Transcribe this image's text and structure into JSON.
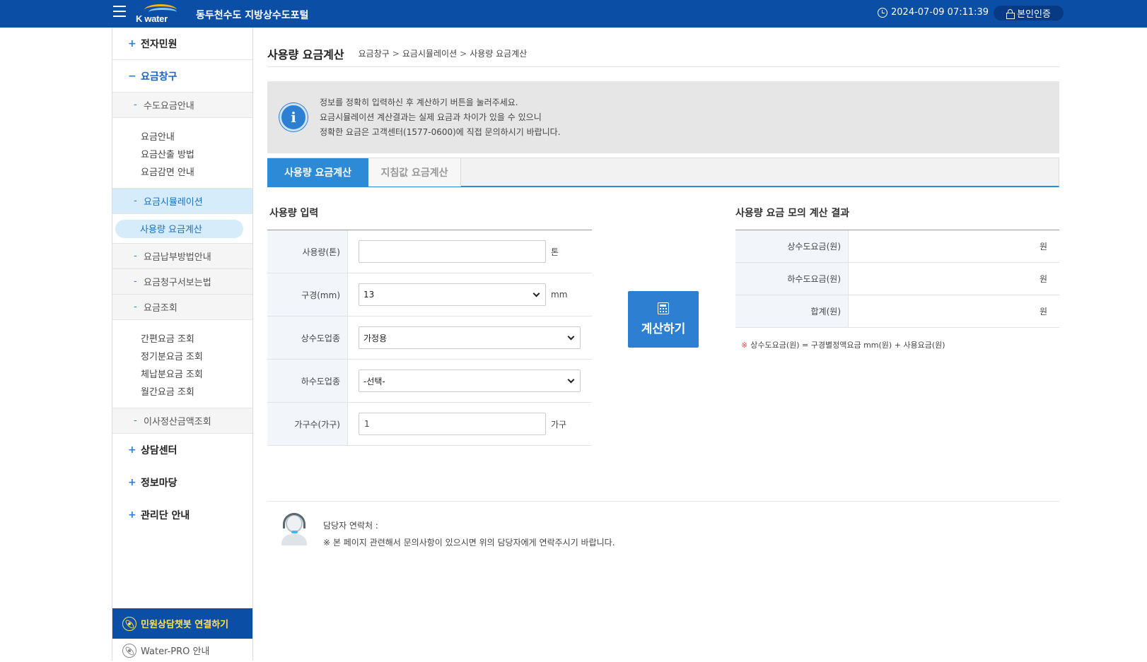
{
  "header": {
    "logo_text": "K water",
    "site_title": "동두천수도 지방상수도포털",
    "datetime": "2024-07-09 07:11:39",
    "auth_label": "본인인증"
  },
  "sidebar": {
    "menu1": "전자민원",
    "menu2": "요금창구",
    "sub_water_fee": "수도요금안내",
    "water_fee_links": [
      "요금안내",
      "요금산출 방법",
      "요금감면 안내"
    ],
    "sub_simulation": "요금시뮬레이션",
    "current_page": "사용량 요금계산",
    "sub_payment": "요금납부방법안내",
    "sub_bill": "요금청구서보는법",
    "sub_inquiry": "요금조회",
    "inquiry_links": [
      "간편요금 조회",
      "정기분요금 조회",
      "체납분요금 조회",
      "월간요금 조회"
    ],
    "sub_move": "이사정산금액조회",
    "menu3": "상담센터",
    "menu4": "정보마당",
    "menu5": "관리단 안내",
    "chatbot": "민원상담챗봇 연결하기",
    "waterpro": "Water-PRO 안내"
  },
  "main": {
    "title": "사용량 요금계산",
    "breadcrumb": [
      "요금창구",
      "요금시뮬레이션",
      "사용량 요금계산"
    ],
    "notice": [
      "정보를 정확히 입력하신 후 계산하기 버튼을 눌러주세요.",
      "요금시뮬레이션 계산결과는 실제 요금과 차이가 있을 수 있으니",
      "정확한 요금은 고객센터(1577-0600)에 직접 문의하시기 바랍니다."
    ],
    "tabs": [
      "사용량 요금계산",
      "지침값 요금계산"
    ]
  },
  "input_section": {
    "title": "사용량 입력",
    "usage_label": "사용량(톤)",
    "usage_value": "",
    "usage_unit": "톤",
    "diameter_label": "구경(mm)",
    "diameter_value": "13",
    "diameter_unit": "mm",
    "water_type_label": "상수도업종",
    "water_type_value": "가정용",
    "sewer_type_label": "하수도업종",
    "sewer_type_value": "-선택-",
    "households_label": "가구수(가구)",
    "households_value": "1",
    "households_unit": "가구"
  },
  "calc_button": "계산하기",
  "result_section": {
    "title": "사용량 요금 모의 계산 결과",
    "rows": [
      {
        "label": "상수도요금(원)",
        "value": "원"
      },
      {
        "label": "하수도요금(원)",
        "value": "원"
      },
      {
        "label": "합계(원)",
        "value": "원"
      }
    ],
    "formula_mark": "※",
    "formula": "상수도요금(원) = 구경별정액요금 mm(원) + 사용요금(원)"
  },
  "contact": {
    "label": "담당자 연락처 :",
    "note": "※ 본 페이지 관련해서 문의사항이 있으시면 위의 담당자에게 연락주시기 바랍니다."
  },
  "colors": {
    "header_bg": "#0a4ea6",
    "accent": "#2c8ad6",
    "chatbot_text": "#ffe25a"
  }
}
